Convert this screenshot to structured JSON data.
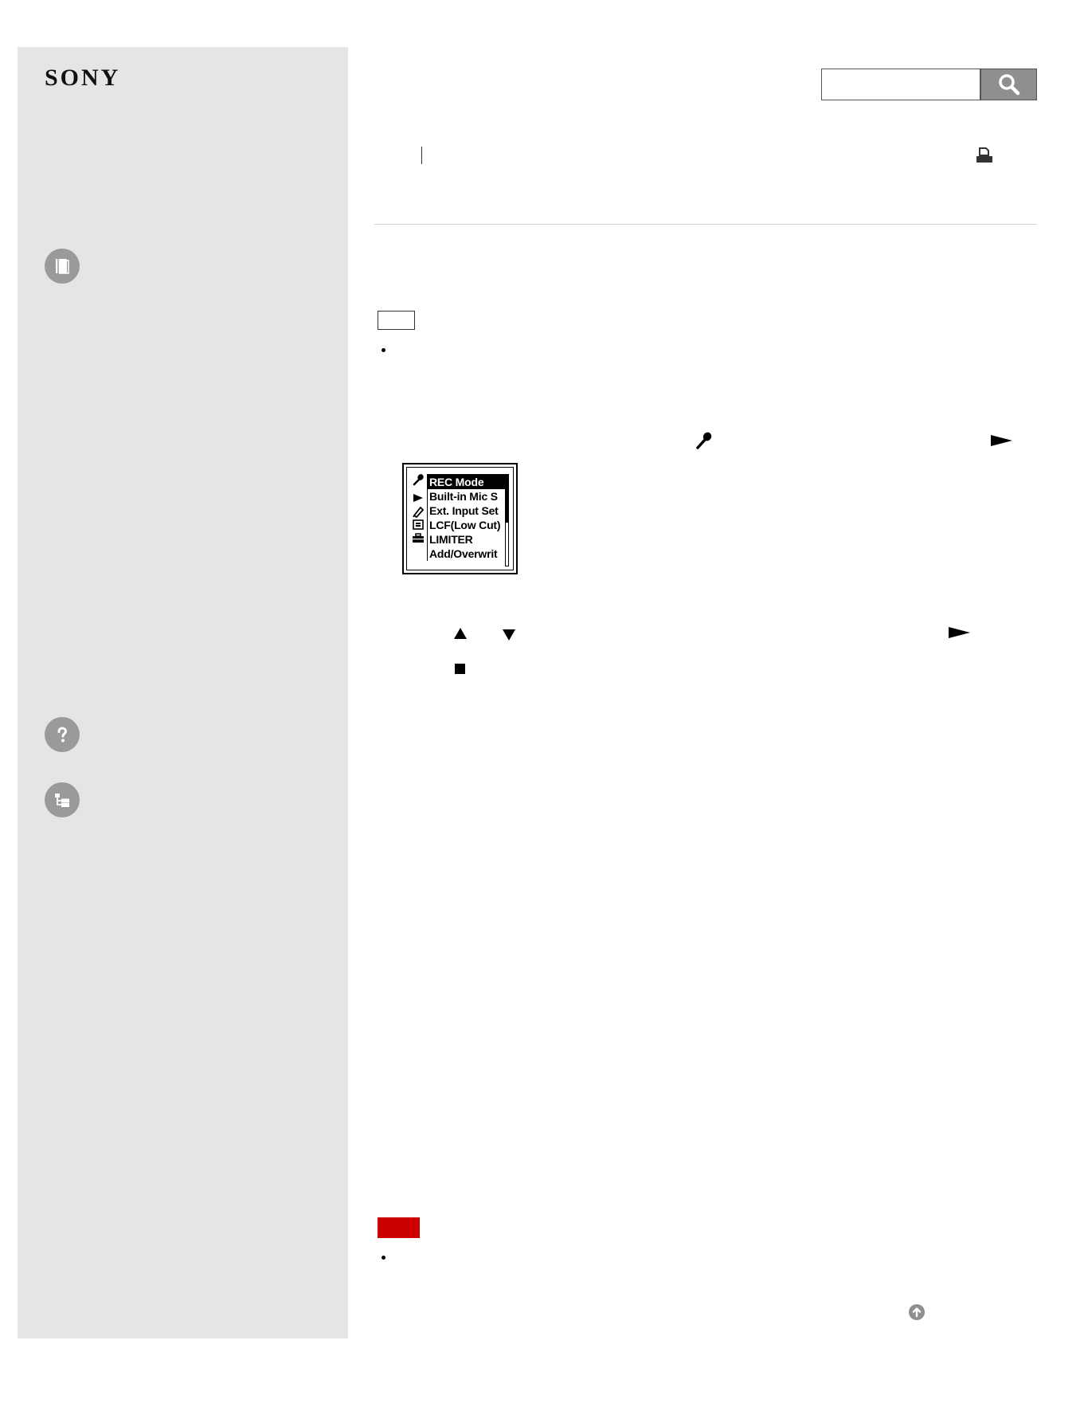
{
  "brand": {
    "logo_text": "SONY"
  },
  "sidebar": {
    "items": [
      {
        "name": "operating-instructions",
        "icon": "book-icon"
      },
      {
        "name": "troubleshooting",
        "icon": "question-icon"
      },
      {
        "name": "contents-list",
        "icon": "list-tree-icon"
      }
    ]
  },
  "search": {
    "value": "",
    "placeholder": ""
  },
  "lcd_menu": {
    "items": [
      {
        "label": "REC Mode",
        "selected": true
      },
      {
        "label": "Built-in Mic S"
      },
      {
        "label": "Ext. Input Set"
      },
      {
        "label": "LCF(Low Cut)"
      },
      {
        "label": "LIMITER"
      },
      {
        "label": "Add/Overwrit"
      }
    ]
  },
  "colors": {
    "sidebar_bg": "#e5e5e5",
    "note_label": "#cc0000",
    "icon_gray": "#9a9a9a"
  }
}
